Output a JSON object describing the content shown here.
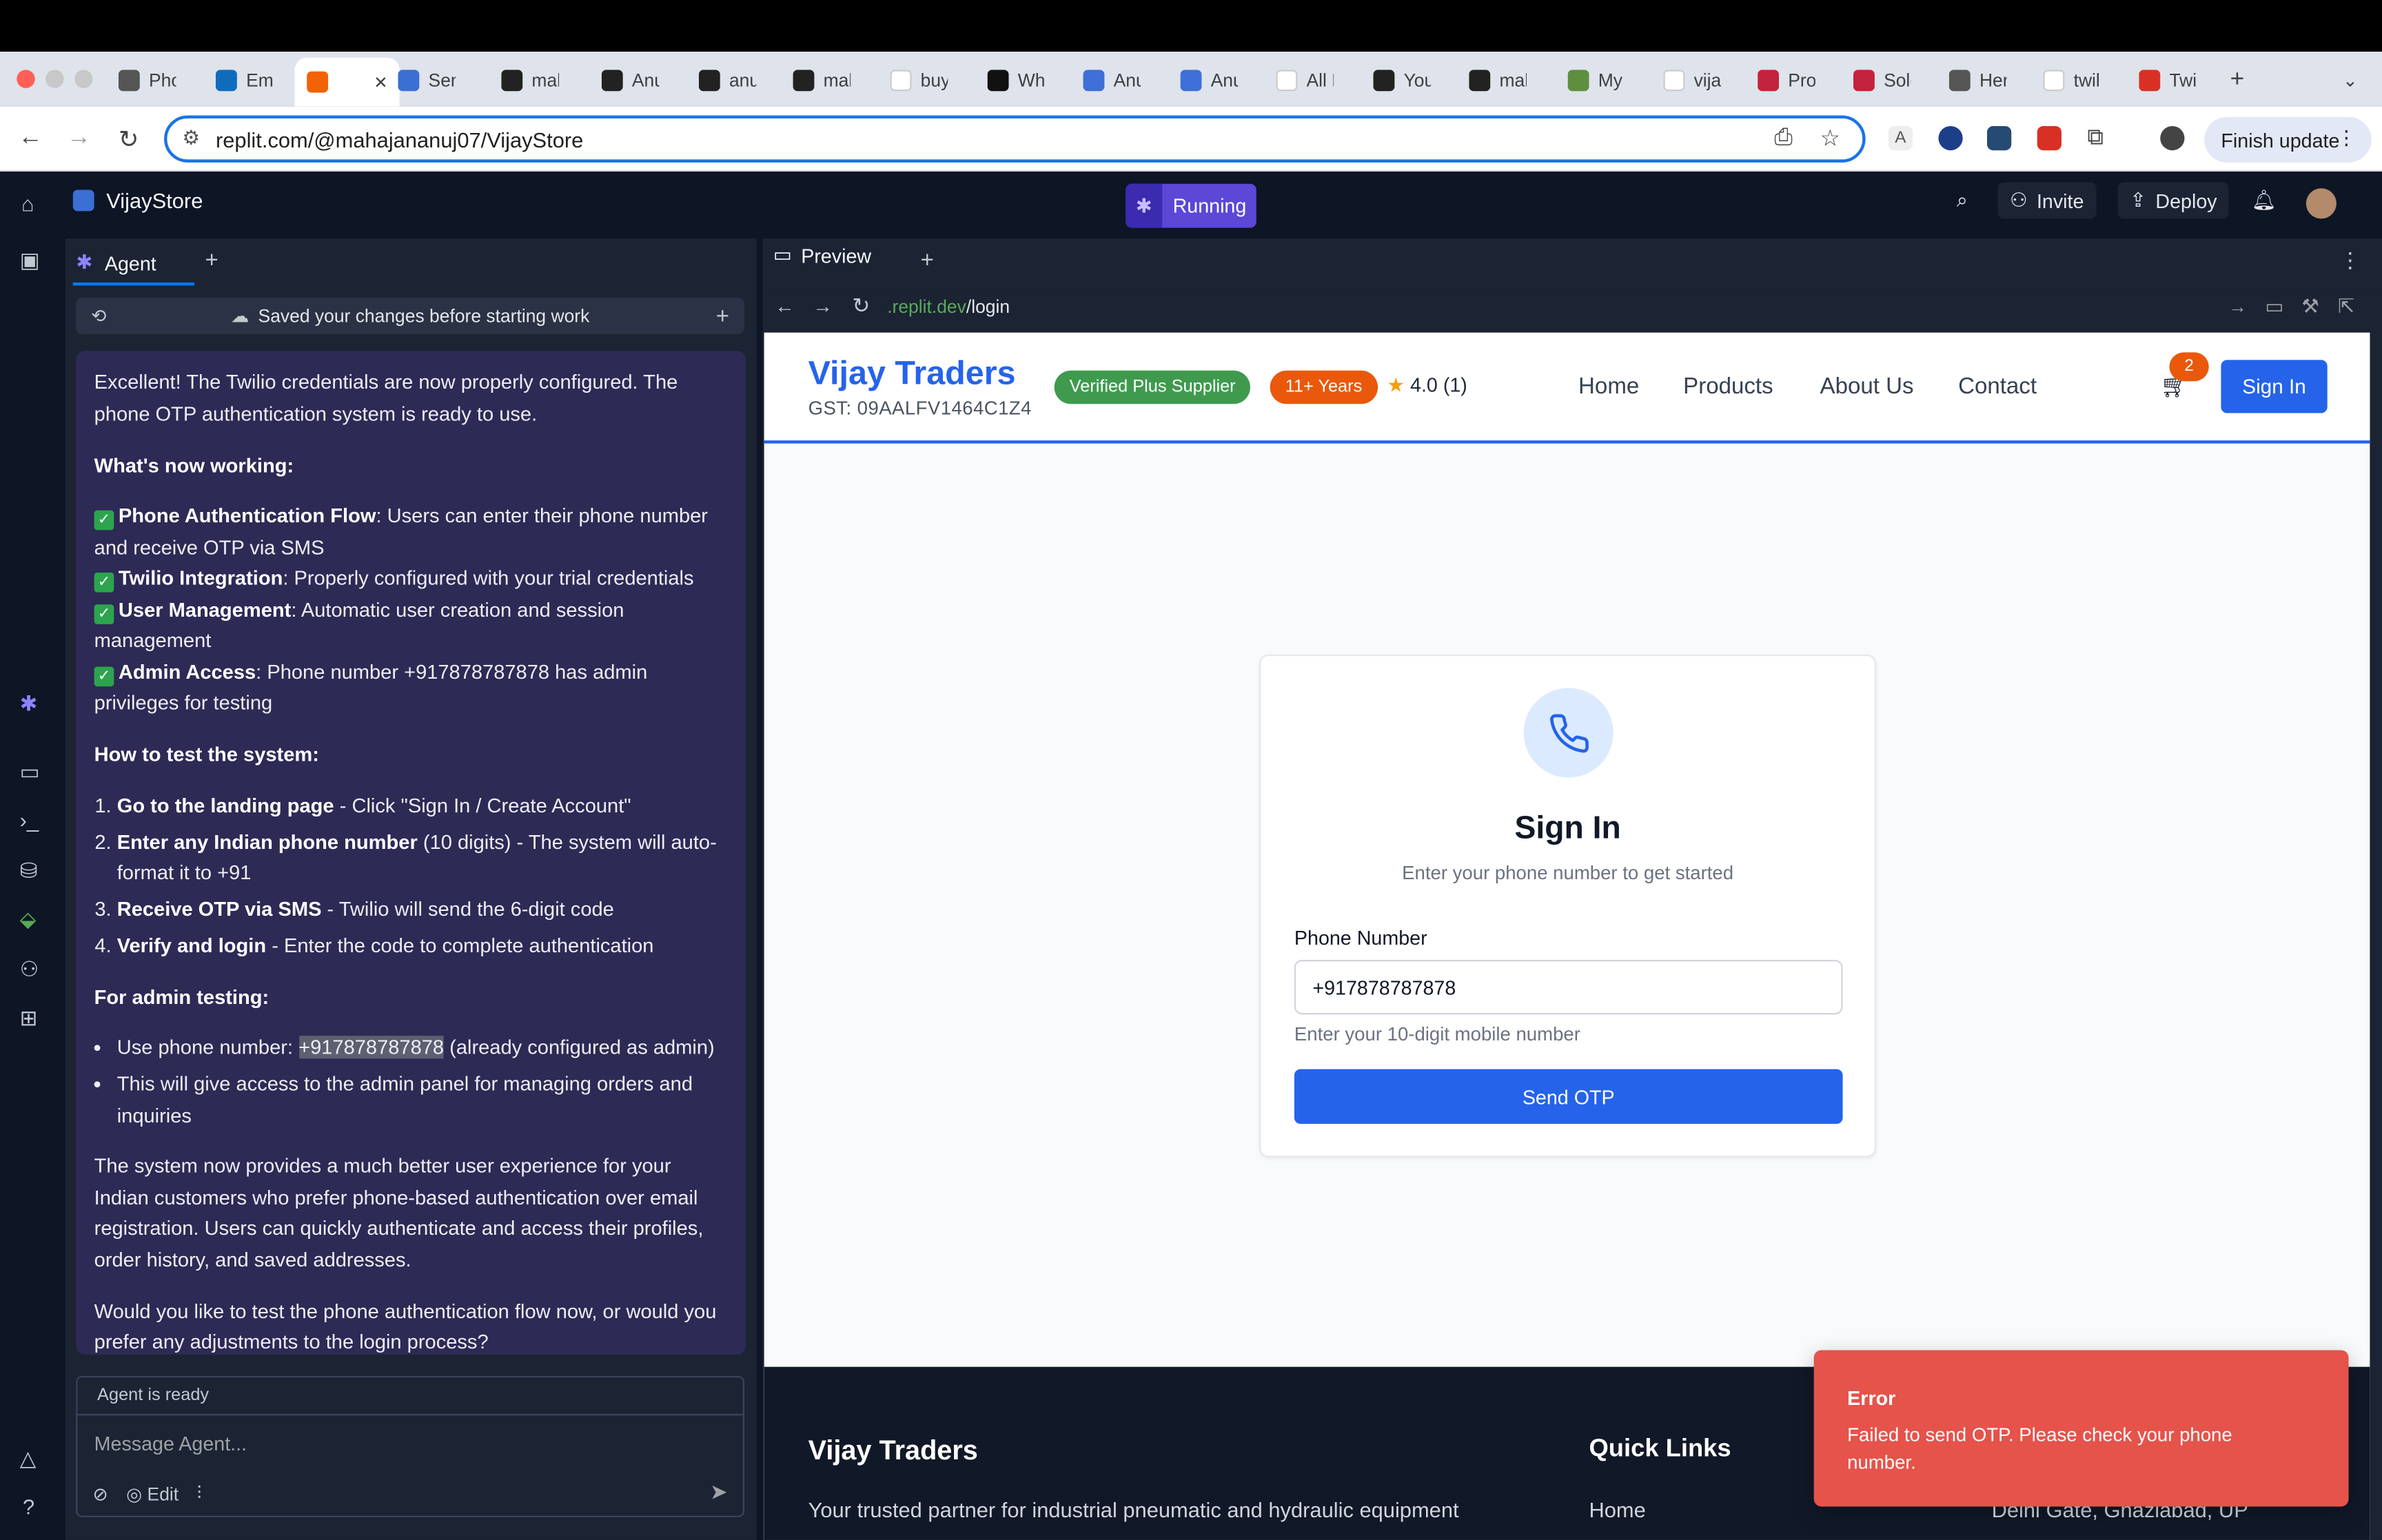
{
  "browser": {
    "tabs": [
      "Pho",
      "Ema",
      "",
      "Sen",
      "mah",
      "Anu",
      "anuj",
      "mah",
      "buy",
      "Whi",
      "Anu",
      "Anu",
      "All N",
      "You",
      "mah",
      "My",
      "vija",
      "Pro",
      "Sole",
      "Here",
      "twil",
      "Twil"
    ],
    "url": "replit.com/@mahajananuj07/VijayStore",
    "finish_update": "Finish update"
  },
  "replit": {
    "project_name": "VijayStore",
    "status": "Running",
    "invite": "Invite",
    "deploy": "Deploy"
  },
  "agent": {
    "tab_label": "Agent",
    "saved_notice": "Saved your changes before starting work",
    "intro": "Excellent! The Twilio credentials are now properly configured. The phone OTP authentication system is ready to use.",
    "working_heading": "What's now working:",
    "working_items": [
      {
        "title": "Phone Authentication Flow",
        "text": ": Users can enter their phone number and receive OTP via SMS"
      },
      {
        "title": "Twilio Integration",
        "text": ": Properly configured with your trial credentials"
      },
      {
        "title": "User Management",
        "text": ": Automatic user creation and session management"
      },
      {
        "title": "Admin Access",
        "text": ": Phone number +917878787878 has admin privileges for testing"
      }
    ],
    "test_heading": "How to test the system:",
    "test_steps": [
      {
        "title": "Go to the landing page",
        "text": " - Click \"Sign In / Create Account\""
      },
      {
        "title": "Enter any Indian phone number",
        "text": " (10 digits) - The system will auto-format it to +91"
      },
      {
        "title": "Receive OTP via SMS",
        "text": " - Twilio will send the 6-digit code"
      },
      {
        "title": "Verify and login",
        "text": " - Enter the code to complete authentication"
      }
    ],
    "admin_heading": "For admin testing:",
    "admin_b1_prefix": "Use phone number: ",
    "admin_b1_number": "+917878787878",
    "admin_b1_suffix": " (already configured as admin)",
    "admin_b2": "This will give access to the admin panel for managing orders and inquiries",
    "summary": "The system now provides a much better user experience for your Indian customers who prefer phone-based authentication over email registration. Users can quickly authenticate and access their profiles, order history, and saved addresses.",
    "question": "Would you like to test the phone authentication flow now, or would you prefer any adjustments to the login process?",
    "ready": "Agent is ready",
    "input_placeholder": "Message Agent...",
    "edit_label": "Edit"
  },
  "preview": {
    "tab_label": "Preview",
    "url_domain": ".replit.dev",
    "url_path": "/login"
  },
  "site": {
    "brand": "Vijay Traders",
    "gst": "GST: 09AALFV1464C1Z4",
    "badge_verified": "Verified Plus Supplier",
    "badge_years": "11+ Years",
    "rating": "4.0 (1)",
    "nav": [
      "Home",
      "Products",
      "About Us",
      "Contact"
    ],
    "cart_count": "2",
    "signin": "Sign In",
    "card_title": "Sign In",
    "card_subtitle": "Enter your phone number to get started",
    "phone_label": "Phone Number",
    "phone_value": "+917878787878",
    "phone_hint": "Enter your 10-digit mobile number",
    "send_otp": "Send OTP",
    "footer_title": "Vijay Traders",
    "footer_text": "Your trusted partner for industrial pneumatic and hydraulic equipment",
    "footer_quick_links": "Quick Links",
    "footer_home": "Home",
    "footer_address": "Delhi Gate, Ghaziabad, UP"
  },
  "toast": {
    "title": "Error",
    "message": "Failed to send OTP. Please check your phone number."
  },
  "colors": {
    "brand_blue": "#2563eb",
    "agent_bubble": "#2d2a55",
    "toast_red": "#e5534b",
    "badge_green": "#3f9a4e",
    "badge_orange": "#ea580c"
  }
}
